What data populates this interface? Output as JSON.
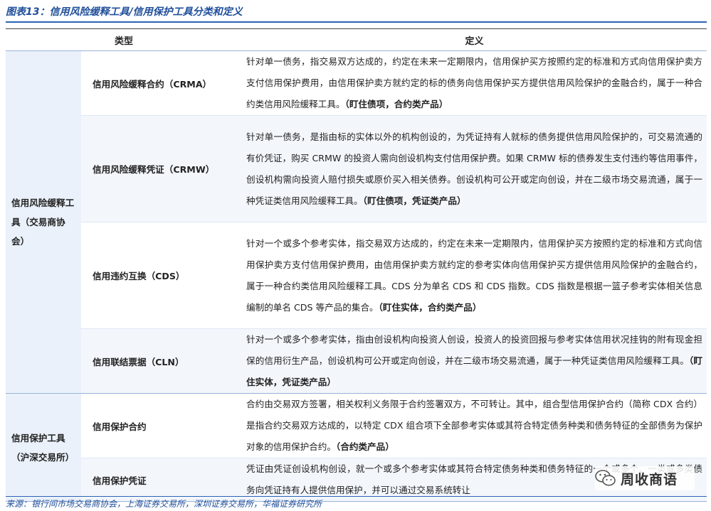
{
  "figure_title": "图表13：信用风险缓释工具/信用保护工具分类和定义",
  "table": {
    "headers": {
      "type": "类型",
      "definition": "定义"
    },
    "groups": [
      {
        "category": "信用风险缓释工具（交易商协会）",
        "rows": [
          {
            "name": "信用风险缓释合约（CRMA）",
            "definition": "针对单一债务，指交易双方达成的，约定在未来一定期限内，信用保护买方按照约定的标准和方式向信用保护卖方支付信用保护费用，由信用保护卖方就约定的标的债务向信用保护买方提供信用风险保护的金融合约，属于一种合约类信用风险缓释工具。",
            "tag": "（盯住债项，合约类产品）"
          },
          {
            "name": "信用风险缓释凭证（CRMW）",
            "definition": "针对单一债务，是指由标的实体以外的机构创设的，为凭证持有人就标的债务提供信用风险保护的，可交易流通的有价凭证，购买 CRMW 的投资人需向创设机构支付信用保护费。如果 CRMW 标的债券发生支付违约等信用事件，创设机构需向投资人赔付损失或原价买入相关债券。创设机构可公开或定向创设，并在二级市场交易流通，属于一种凭证类信用风险缓释工具。",
            "tag": "（盯住债项，凭证类产品）"
          },
          {
            "name": "信用违约互换（CDS）",
            "definition": "针对一个或多个参考实体，指交易双方达成的，约定在未来一定期限内，信用保护买方按照约定的标准和方式向信用保护卖方支付信用保护费用，由信用保护卖方就约定的参考实体向信用保护买方提供信用风险保护的金融合约，属于一种合约类信用风险缓释工具。CDS 分为单名 CDS 和 CDS 指数。CDS 指数是根据一篮子参考实体相关信息编制的单名 CDS 等产品的集合。",
            "tag": "（盯住实体，合约类产品）"
          },
          {
            "name": "信用联结票据（CLN）",
            "definition": "针对一个或多个参考实体，指由创设机构向投资人创设，投资人的投资回报与参考实体信用状况挂钩的附有现金担保的信用衍生产品，创设机构可公开或定向创设，并在二级市场交易流通，属于一种凭证类信用风险缓释工具。",
            "tag": "（盯住实体，凭证类产品）"
          }
        ]
      },
      {
        "category": "信用保护工具（沪深交易所）",
        "rows": [
          {
            "name": "信用保护合约",
            "definition": "合约由交易双方签署，相关权利义务限于合约签署双方，不可转让。其中，组合型信用保护合约（简称 CDX 合约）是指合约交易双方达成的，以特定 CDX 组合项下全部参考实体或其符合特定债务种类和债务特征的全部债务为保护对象的信用保护合约。",
            "tag": "（合约类产品）"
          },
          {
            "name": "信用保护凭证",
            "definition": "凭证由凭证创设机构创设，就一个或多个参考实体或其符合特定债务种类和债务特征的一个或多个、一类或多类债务向凭证持有人提供信用保护，并可以通过交易系统转让",
            "tag": ""
          }
        ]
      }
    ]
  },
  "source": "来源：银行间市场交易商协会，上海证券交易所，深圳证券交易所，华福证券研究所",
  "watermark": {
    "text": "周收商语",
    "icon": "wechat-icon"
  },
  "colors": {
    "title": "#1f4e9a",
    "category_bg": "#eaf1fa",
    "alt_row_bg": "#f3f7fc"
  }
}
